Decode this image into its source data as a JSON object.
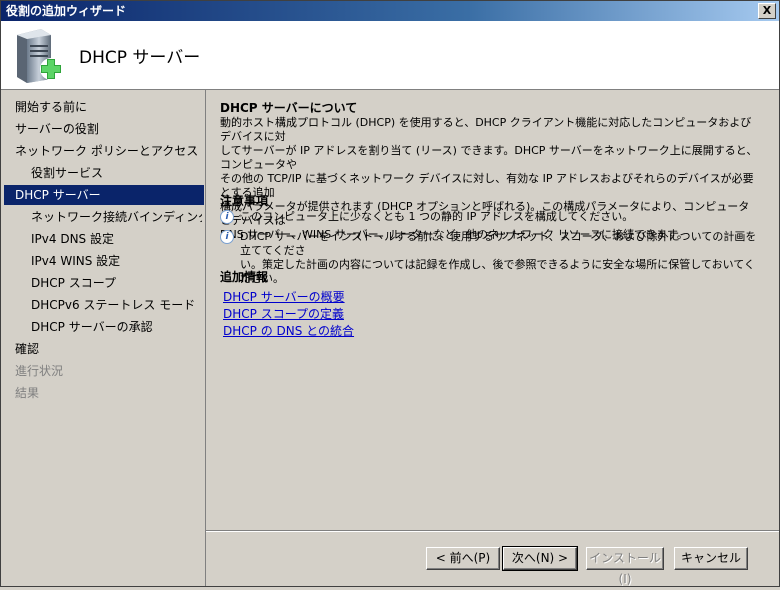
{
  "window": {
    "title": "役割の追加ウィザード",
    "close_label": "X"
  },
  "header": {
    "heading": "DHCP サーバー"
  },
  "sidebar": {
    "items": [
      {
        "label": "開始する前に",
        "level": 1,
        "state": "normal"
      },
      {
        "label": "サーバーの役割",
        "level": 1,
        "state": "normal"
      },
      {
        "label": "ネットワーク ポリシーとアクセス サービ...",
        "level": 1,
        "state": "normal"
      },
      {
        "label": "役割サービス",
        "level": 2,
        "state": "normal"
      },
      {
        "label": "DHCP サーバー",
        "level": 1,
        "state": "active"
      },
      {
        "label": "ネットワーク接続バインディング",
        "level": 2,
        "state": "normal"
      },
      {
        "label": "IPv4 DNS 設定",
        "level": 2,
        "state": "normal"
      },
      {
        "label": "IPv4 WINS 設定",
        "level": 2,
        "state": "normal"
      },
      {
        "label": "DHCP スコープ",
        "level": 2,
        "state": "normal"
      },
      {
        "label": "DHCPv6 ステートレス モード",
        "level": 2,
        "state": "normal"
      },
      {
        "label": "DHCP サーバーの承認",
        "level": 2,
        "state": "normal"
      },
      {
        "label": "確認",
        "level": 1,
        "state": "normal"
      },
      {
        "label": "進行状況",
        "level": 1,
        "state": "disabled"
      },
      {
        "label": "結果",
        "level": 1,
        "state": "disabled"
      }
    ]
  },
  "main": {
    "about_title": "DHCP サーバーについて",
    "about_lines": [
      "動的ホスト構成プロトコル (DHCP) を使用すると、DHCP クライアント機能に対応したコンピュータおよびデバイスに対",
      "してサーバーが IP アドレスを割り当て (リース) できます。DHCP サーバーをネットワーク上に展開すると、コンピュータや",
      "その他の TCP/IP に基づくネットワーク デバイスに対し、有効な IP アドレスおよびそれらのデバイスが必要とする追加",
      "構成パラメータが提供されます (DHCP オプションと呼ばれる)。この構成パラメータにより、コンピュータとデバイスは",
      "DNS サーバー、WINS サーバー、ルーターなど、他のネットワーク リソースに接続できます。"
    ],
    "notes_title": "注意事項",
    "note1": "このコンピュータ上に少なくとも 1 つの静的 IP アドレスを構成してください。",
    "note2_lines": [
      "DHCP サーバーをインストールする前に、使用するサブネット、スコープ、および除外についての計画を立ててくださ",
      "い。策定した計画の内容については記録を作成し、後で参照できるように安全な場所に保管しておいてください。"
    ],
    "info_title": "追加情報",
    "links": [
      "DHCP サーバーの概要",
      "DHCP スコープの定義",
      "DHCP の DNS との統合"
    ]
  },
  "buttons": {
    "back": "< 前へ(P)",
    "next": "次へ(N) >",
    "install": "インストール(I)",
    "cancel": "キャンセル"
  },
  "icons": {
    "header_icon": "server-add-icon",
    "info_icon": "info-icon"
  }
}
